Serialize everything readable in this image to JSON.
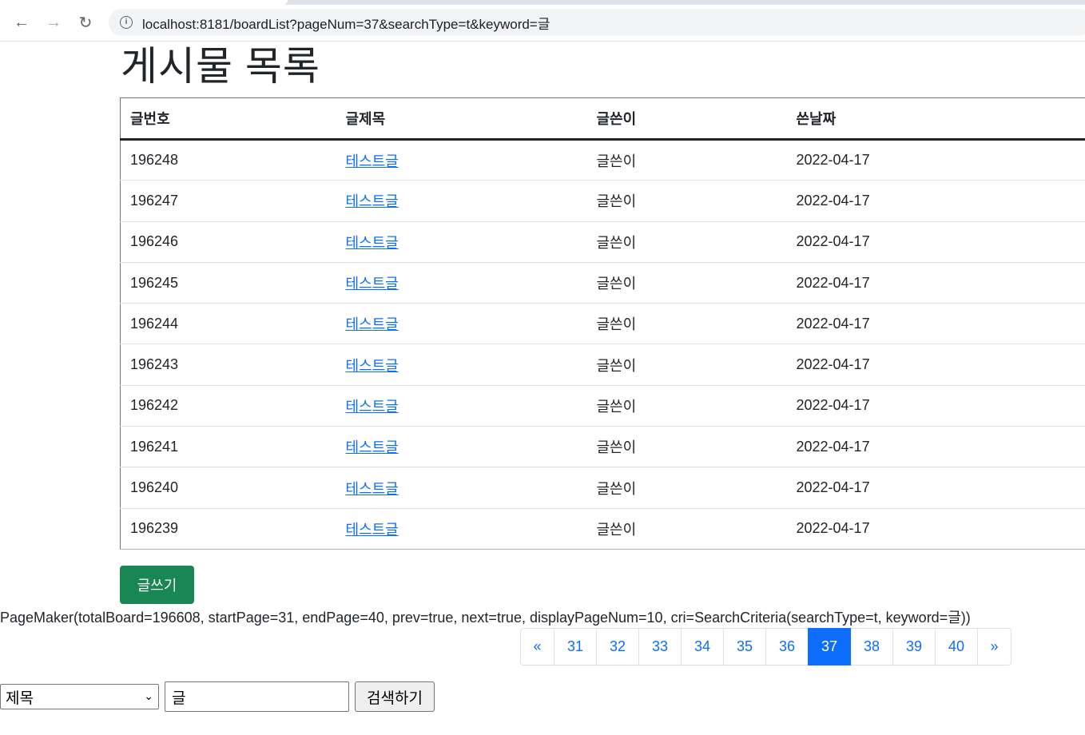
{
  "browser": {
    "url": "localhost:8181/boardList?pageNum=37&searchType=t&keyword=글",
    "back_icon": "←",
    "forward_icon": "→",
    "reload_icon": "↻",
    "info_icon": "i"
  },
  "page": {
    "title": "게시물 목록"
  },
  "table": {
    "headers": [
      "글번호",
      "글제목",
      "글쓴이",
      "쓴날짜"
    ],
    "rows": [
      {
        "no": "196248",
        "title": "테스트글",
        "writer": "글쓴이",
        "date": "2022-04-17"
      },
      {
        "no": "196247",
        "title": "테스트글",
        "writer": "글쓴이",
        "date": "2022-04-17"
      },
      {
        "no": "196246",
        "title": "테스트글",
        "writer": "글쓴이",
        "date": "2022-04-17"
      },
      {
        "no": "196245",
        "title": "테스트글",
        "writer": "글쓴이",
        "date": "2022-04-17"
      },
      {
        "no": "196244",
        "title": "테스트글",
        "writer": "글쓴이",
        "date": "2022-04-17"
      },
      {
        "no": "196243",
        "title": "테스트글",
        "writer": "글쓴이",
        "date": "2022-04-17"
      },
      {
        "no": "196242",
        "title": "테스트글",
        "writer": "글쓴이",
        "date": "2022-04-17"
      },
      {
        "no": "196241",
        "title": "테스트글",
        "writer": "글쓴이",
        "date": "2022-04-17"
      },
      {
        "no": "196240",
        "title": "테스트글",
        "writer": "글쓴이",
        "date": "2022-04-17"
      },
      {
        "no": "196239",
        "title": "테스트글",
        "writer": "글쓴이",
        "date": "2022-04-17"
      }
    ]
  },
  "write_button": "글쓰기",
  "page_maker_text": "PageMaker(totalBoard=196608, startPage=31, endPage=40, prev=true, next=true, displayPageNum=10, cri=SearchCriteria(searchType=t, keyword=글))",
  "pagination": {
    "prev": "«",
    "next": "»",
    "pages": [
      "31",
      "32",
      "33",
      "34",
      "35",
      "36",
      "37",
      "38",
      "39",
      "40"
    ],
    "active": "37"
  },
  "search": {
    "select_value": "제목",
    "select_chevron": "⌄",
    "keyword": "글",
    "button": "검색하기"
  }
}
